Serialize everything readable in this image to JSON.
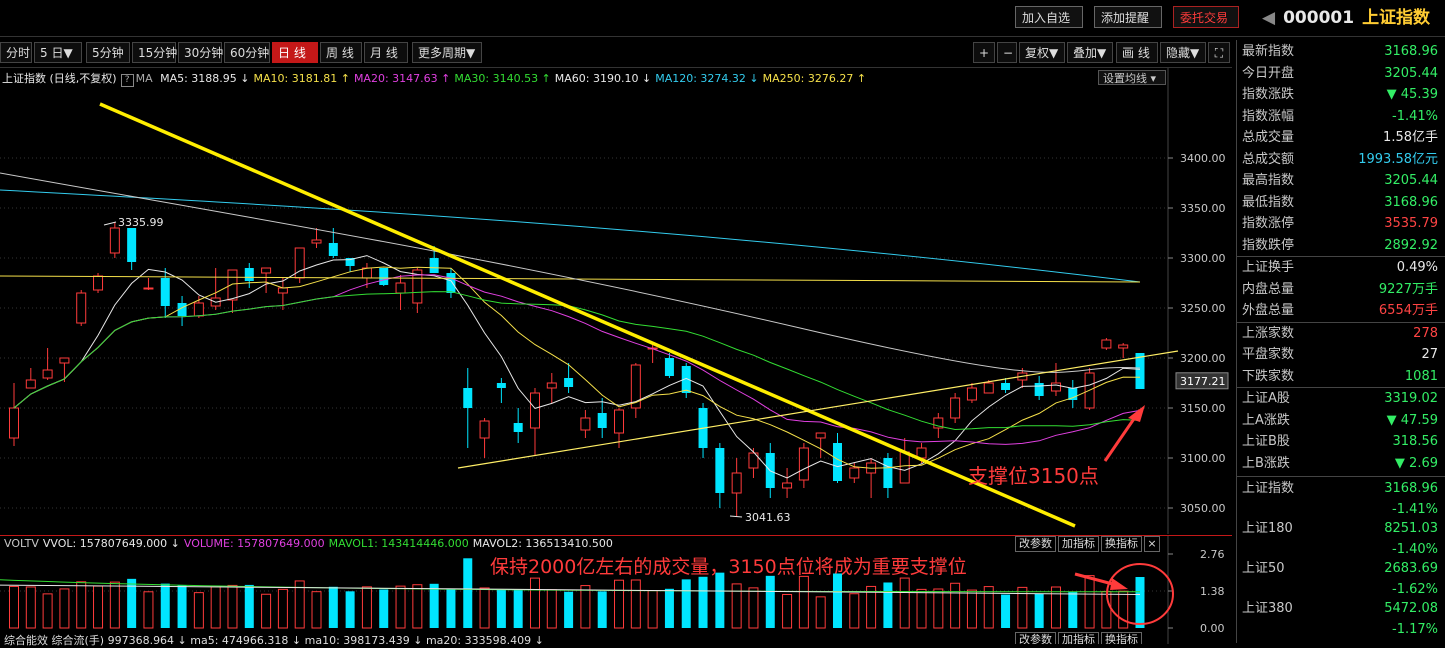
{
  "topbar": {
    "buttons": [
      {
        "label": "加入自选",
        "style": "normal"
      },
      {
        "label": "添加提醒",
        "style": "normal"
      },
      {
        "label": "委托交易",
        "style": "red"
      }
    ],
    "symbol_code": "000001",
    "symbol_name": "上证指数"
  },
  "toolbar": {
    "periods": [
      "分时",
      "5 日▼",
      "5分钟",
      "15分钟",
      "30分钟",
      "60分钟",
      "日 线",
      "周 线",
      "月 线",
      "更多周期▼"
    ],
    "active_period": "日 线",
    "tools": [
      "+",
      "−",
      "复权▼",
      "叠加▼",
      "画 线",
      "隐藏▼"
    ]
  },
  "main": {
    "indicator_title": "上证指数 (日线,不复权)",
    "help_icon": "?",
    "ma_items": [
      {
        "label": "MA5: 3188.95 ↓",
        "color": "#e8e8e8"
      },
      {
        "label": "MA10: 3181.81 ↑",
        "color": "#f5e04a"
      },
      {
        "label": "MA20: 3147.63 ↑",
        "color": "#e040e0"
      },
      {
        "label": "MA30: 3140.53 ↑",
        "color": "#33dd33"
      },
      {
        "label": "MA60: 3190.10 ↓",
        "color": "#e8e8e8"
      },
      {
        "label": "MA120: 3274.32 ↓",
        "color": "#33ccee"
      },
      {
        "label": "MA250: 3276.27 ↑",
        "color": "#f5e04a"
      }
    ],
    "ma_prefix": "MA",
    "settings_label": "设置均线",
    "current_price_tag": "3177.21",
    "annotation_support": "支撑位3150点",
    "high_label": "3335.99",
    "low_label": "3041.63"
  },
  "volume": {
    "header_items": [
      {
        "label": "VOLTV",
        "color": "#c8c8c8"
      },
      {
        "label": "VVOL: 157807649.000 ↓",
        "color": "#e8e8e8"
      },
      {
        "label": "VOLUME: 157807649.000",
        "color": "#e040e0"
      },
      {
        "label": "MAVOL1: 143414446.000",
        "color": "#33dd33"
      },
      {
        "label": "MAVOL2: 136513410.500",
        "color": "#e8e8e8"
      }
    ],
    "buttons": [
      "改参数",
      "加指标",
      "换指标"
    ],
    "annotation": "保持2000亿左右的成交量，3150点位将成为重要支撑位",
    "bottom_partial": "综合能效  综合流(手)  997368.964 ↓  ma5: 474966.318 ↓  ma10: 398173.439 ↓  ma20: 333598.409 ↓",
    "bottom_buttons": [
      "改参数",
      "加指标",
      "换指标"
    ]
  },
  "panel": {
    "rows": [
      {
        "label": "最新指数",
        "value": "3168.96",
        "color": "#33ee66"
      },
      {
        "label": "今日开盘",
        "value": "3205.44",
        "color": "#33ee66"
      },
      {
        "label": "指数涨跌",
        "value": "▼ 45.39",
        "color": "#33ee66"
      },
      {
        "label": "指数涨幅",
        "value": "-1.41%",
        "color": "#33ee66"
      },
      {
        "label": "总成交量",
        "value": "1.58亿手",
        "color": "#e8e8e8"
      },
      {
        "label": "总成交额",
        "value": "1993.58亿元",
        "color": "#33ccee"
      },
      {
        "label": "最高指数",
        "value": "3205.44",
        "color": "#33ee66"
      },
      {
        "label": "最低指数",
        "value": "3168.96",
        "color": "#33ee66"
      },
      {
        "label": "指数涨停",
        "value": "3535.79",
        "color": "#ff4444"
      },
      {
        "label": "指数跌停",
        "value": "2892.92",
        "color": "#33ee66"
      },
      {
        "label": "上证换手",
        "value": "0.49%",
        "color": "#e8e8e8"
      },
      {
        "label": "内盘总量",
        "value": "9227万手",
        "color": "#33ee66"
      },
      {
        "label": "外盘总量",
        "value": "6554万手",
        "color": "#ff4444"
      },
      {
        "label": "上涨家数",
        "value": "278",
        "color": "#ff4444"
      },
      {
        "label": "平盘家数",
        "value": "27",
        "color": "#e8e8e8"
      },
      {
        "label": "下跌家数",
        "value": "1081",
        "color": "#33ee66"
      },
      {
        "label": "上证A股",
        "value": "3319.02",
        "color": "#33ee66"
      },
      {
        "label": "上A涨跌",
        "value": "▼ 47.59",
        "color": "#33ee66"
      },
      {
        "label": "上证B股",
        "value": "318.56",
        "color": "#33ee66"
      },
      {
        "label": "上B涨跌",
        "value": "▼ 2.69",
        "color": "#33ee66"
      }
    ],
    "indices": [
      {
        "label": "上证指数",
        "value": "3168.96",
        "pct": "-1.41%"
      },
      {
        "label": "上证180",
        "value": "8251.03",
        "pct": "-1.40%"
      },
      {
        "label": "上证50",
        "value": "2683.69",
        "pct": "-1.62%"
      },
      {
        "label": "上证380",
        "value": "5472.08",
        "pct": "-1.17%"
      }
    ]
  },
  "chart_data": {
    "type": "candlestick",
    "ylim": [
      3030,
      3470
    ],
    "yticks": [
      3050,
      3100,
      3150,
      3200,
      3250,
      3300,
      3350,
      3400
    ],
    "up_color": "#ff3b3b",
    "down_color": "#00e5ff",
    "candles": [
      {
        "o": 3120,
        "h": 3175,
        "l": 3112,
        "c": 3150
      },
      {
        "o": 3170,
        "h": 3190,
        "l": 3170,
        "c": 3178
      },
      {
        "o": 3180,
        "h": 3210,
        "l": 3178,
        "c": 3188
      },
      {
        "o": 3195,
        "h": 3200,
        "l": 3176,
        "c": 3200
      },
      {
        "o": 3235,
        "h": 3268,
        "l": 3232,
        "c": 3265
      },
      {
        "o": 3268,
        "h": 3285,
        "l": 3265,
        "c": 3282
      },
      {
        "o": 3305,
        "h": 3336,
        "l": 3300,
        "c": 3330
      },
      {
        "o": 3330,
        "h": 3330,
        "l": 3288,
        "c": 3296
      },
      {
        "o": 3270,
        "h": 3280,
        "l": 3268,
        "c": 3270
      },
      {
        "o": 3280,
        "h": 3290,
        "l": 3240,
        "c": 3252
      },
      {
        "o": 3255,
        "h": 3262,
        "l": 3232,
        "c": 3242
      },
      {
        "o": 3242,
        "h": 3262,
        "l": 3240,
        "c": 3255
      },
      {
        "o": 3252,
        "h": 3290,
        "l": 3248,
        "c": 3260
      },
      {
        "o": 3258,
        "h": 3286,
        "l": 3245,
        "c": 3288
      },
      {
        "o": 3290,
        "h": 3295,
        "l": 3270,
        "c": 3277
      },
      {
        "o": 3285,
        "h": 3290,
        "l": 3265,
        "c": 3290
      },
      {
        "o": 3265,
        "h": 3280,
        "l": 3248,
        "c": 3270
      },
      {
        "o": 3280,
        "h": 3310,
        "l": 3275,
        "c": 3310
      },
      {
        "o": 3315,
        "h": 3330,
        "l": 3310,
        "c": 3318
      },
      {
        "o": 3315,
        "h": 3330,
        "l": 3300,
        "c": 3302
      },
      {
        "o": 3300,
        "h": 3300,
        "l": 3286,
        "c": 3292
      },
      {
        "o": 3280,
        "h": 3295,
        "l": 3270,
        "c": 3290
      },
      {
        "o": 3290,
        "h": 3290,
        "l": 3272,
        "c": 3273
      },
      {
        "o": 3265,
        "h": 3283,
        "l": 3248,
        "c": 3275
      },
      {
        "o": 3255,
        "h": 3290,
        "l": 3245,
        "c": 3288
      },
      {
        "o": 3300,
        "h": 3312,
        "l": 3290,
        "c": 3285
      },
      {
        "o": 3285,
        "h": 3290,
        "l": 3260,
        "c": 3265
      },
      {
        "o": 3170,
        "h": 3190,
        "l": 3110,
        "c": 3150
      },
      {
        "o": 3120,
        "h": 3140,
        "l": 3100,
        "c": 3137
      },
      {
        "o": 3175,
        "h": 3180,
        "l": 3155,
        "c": 3170
      },
      {
        "o": 3135,
        "h": 3150,
        "l": 3115,
        "c": 3126
      },
      {
        "o": 3130,
        "h": 3170,
        "l": 3102,
        "c": 3165
      },
      {
        "o": 3170,
        "h": 3185,
        "l": 3155,
        "c": 3175
      },
      {
        "o": 3180,
        "h": 3195,
        "l": 3165,
        "c": 3171
      },
      {
        "o": 3128,
        "h": 3148,
        "l": 3120,
        "c": 3140
      },
      {
        "o": 3145,
        "h": 3160,
        "l": 3120,
        "c": 3130
      },
      {
        "o": 3125,
        "h": 3150,
        "l": 3110,
        "c": 3148
      },
      {
        "o": 3150,
        "h": 3195,
        "l": 3140,
        "c": 3193
      },
      {
        "o": 3210,
        "h": 3215,
        "l": 3195,
        "c": 3210
      },
      {
        "o": 3200,
        "h": 3205,
        "l": 3180,
        "c": 3182
      },
      {
        "o": 3192,
        "h": 3195,
        "l": 3160,
        "c": 3165
      },
      {
        "o": 3150,
        "h": 3155,
        "l": 3100,
        "c": 3110
      },
      {
        "o": 3110,
        "h": 3115,
        "l": 3050,
        "c": 3065
      },
      {
        "o": 3065,
        "h": 3100,
        "l": 3042,
        "c": 3085
      },
      {
        "o": 3090,
        "h": 3110,
        "l": 3080,
        "c": 3105
      },
      {
        "o": 3105,
        "h": 3115,
        "l": 3060,
        "c": 3070
      },
      {
        "o": 3070,
        "h": 3090,
        "l": 3060,
        "c": 3075
      },
      {
        "o": 3078,
        "h": 3115,
        "l": 3070,
        "c": 3110
      },
      {
        "o": 3120,
        "h": 3125,
        "l": 3100,
        "c": 3125
      },
      {
        "o": 3115,
        "h": 3125,
        "l": 3075,
        "c": 3077
      },
      {
        "o": 3080,
        "h": 3095,
        "l": 3075,
        "c": 3090
      },
      {
        "o": 3085,
        "h": 3100,
        "l": 3060,
        "c": 3095
      },
      {
        "o": 3100,
        "h": 3105,
        "l": 3060,
        "c": 3070
      },
      {
        "o": 3075,
        "h": 3120,
        "l": 3075,
        "c": 3106
      },
      {
        "o": 3100,
        "h": 3115,
        "l": 3095,
        "c": 3110
      },
      {
        "o": 3130,
        "h": 3145,
        "l": 3120,
        "c": 3140
      },
      {
        "o": 3140,
        "h": 3165,
        "l": 3135,
        "c": 3160
      },
      {
        "o": 3158,
        "h": 3175,
        "l": 3155,
        "c": 3170
      },
      {
        "o": 3165,
        "h": 3178,
        "l": 3165,
        "c": 3175
      },
      {
        "o": 3175,
        "h": 3180,
        "l": 3165,
        "c": 3168
      },
      {
        "o": 3178,
        "h": 3190,
        "l": 3170,
        "c": 3185
      },
      {
        "o": 3175,
        "h": 3182,
        "l": 3158,
        "c": 3162
      },
      {
        "o": 3167,
        "h": 3195,
        "l": 3162,
        "c": 3175
      },
      {
        "o": 3170,
        "h": 3178,
        "l": 3150,
        "c": 3158
      },
      {
        "o": 3150,
        "h": 3190,
        "l": 3148,
        "c": 3185
      },
      {
        "o": 3210,
        "h": 3220,
        "l": 3208,
        "c": 3218
      },
      {
        "o": 3210,
        "h": 3215,
        "l": 3200,
        "c": 3213
      },
      {
        "o": 3205,
        "h": 3205,
        "l": 3169,
        "c": 3169
      }
    ],
    "volume_ylim": [
      0,
      2.76
    ],
    "volume_ticks": [
      "2.76",
      "1.38",
      "0.00"
    ]
  }
}
